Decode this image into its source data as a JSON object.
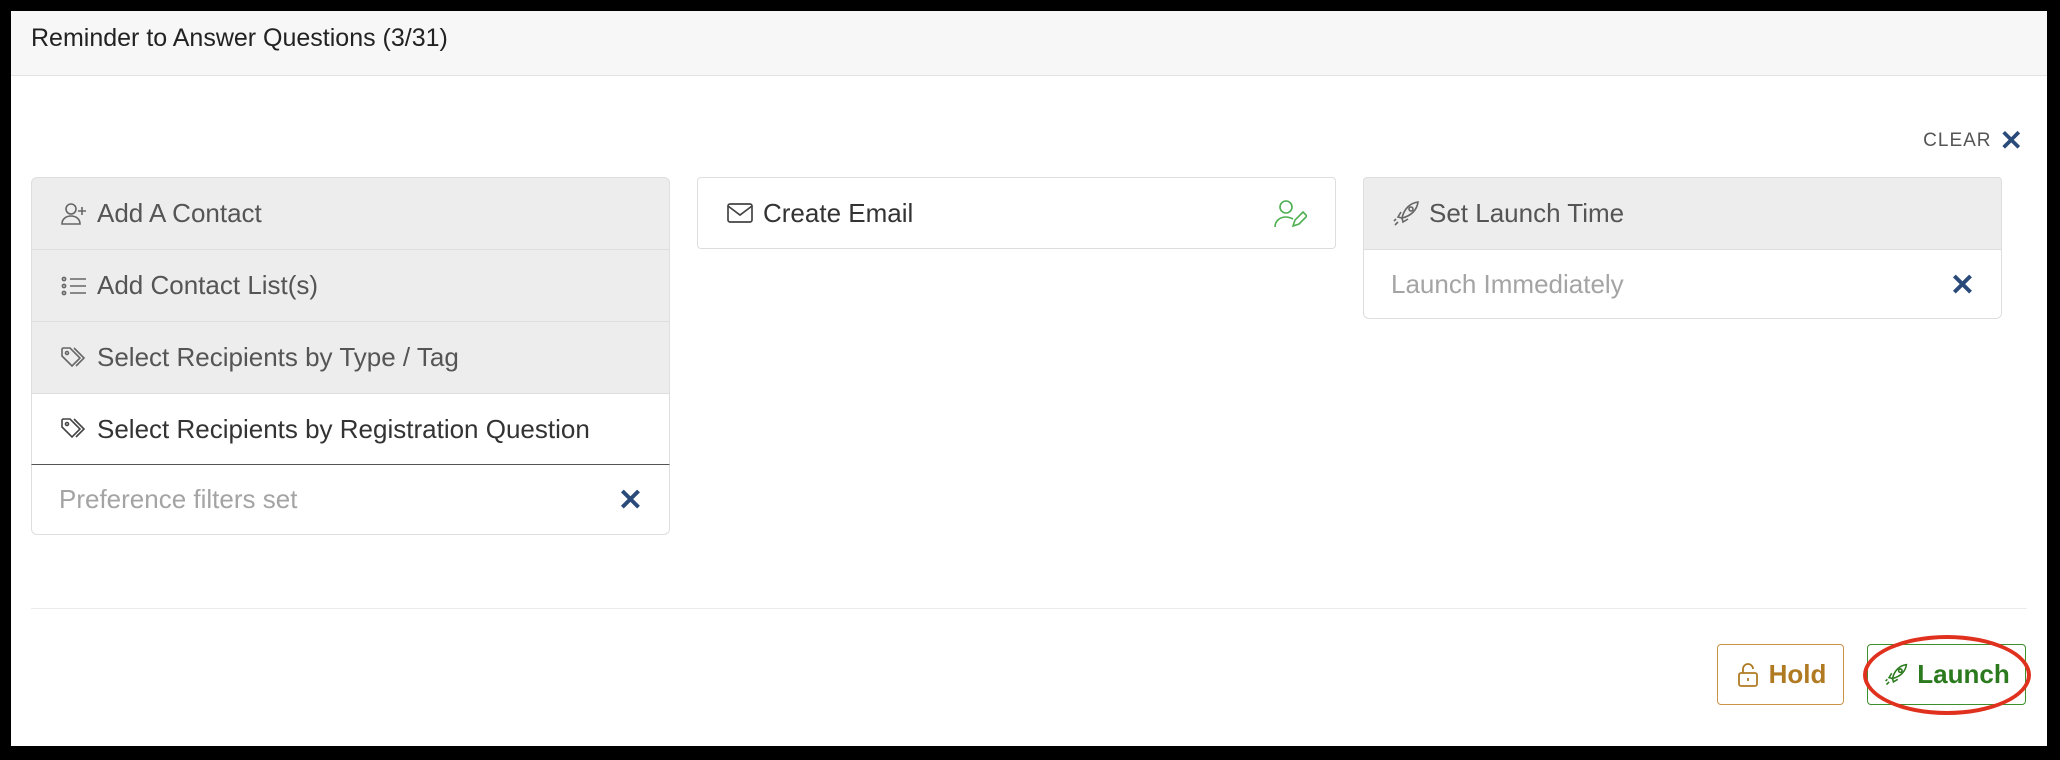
{
  "window": {
    "title": "Reminder to Answer Questions (3/31)"
  },
  "clear": {
    "label": "CLEAR"
  },
  "recipients": {
    "items": [
      {
        "label": "Add A Contact",
        "icon": "add-user-icon"
      },
      {
        "label": "Add Contact List(s)",
        "icon": "list-icon"
      },
      {
        "label": "Select Recipients by Type / Tag",
        "icon": "tags-icon"
      },
      {
        "label": "Select Recipients by Registration Question",
        "icon": "tags-icon"
      }
    ],
    "value": "Preference filters set"
  },
  "email": {
    "label": "Create Email",
    "icon": "envelope-icon",
    "edit_icon": "user-edit-icon",
    "edit_icon_color": "#4caf50"
  },
  "launch_time": {
    "label": "Set Launch Time",
    "icon": "rocket-icon",
    "value": "Launch Immediately"
  },
  "actions": {
    "hold_label": "Hold",
    "hold_color": "#b07a23",
    "launch_label": "Launch",
    "launch_color": "#2b7a1e",
    "highlight_color": "#e0301e"
  }
}
